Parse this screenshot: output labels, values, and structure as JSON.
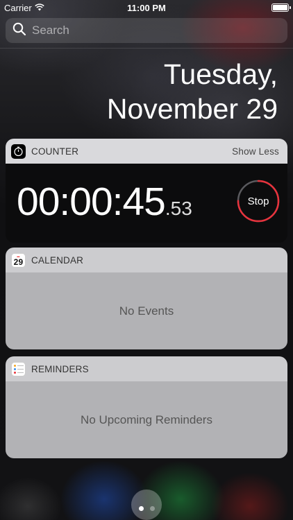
{
  "status_bar": {
    "carrier": "Carrier",
    "time": "11:00 PM",
    "battery_level": 1.0
  },
  "search": {
    "placeholder": "Search",
    "value": ""
  },
  "date": {
    "line1": "Tuesday,",
    "line2": "November 29"
  },
  "counter_widget": {
    "title": "COUNTER",
    "show_less_label": "Show Less",
    "time_main": "00:00:45",
    "time_fraction": ".53",
    "stop_label": "Stop",
    "ring_color": "#e8323c",
    "ring_progress": 0.75
  },
  "calendar_widget": {
    "title": "CALENDAR",
    "icon_day": "29",
    "empty_text": "No Events"
  },
  "reminders_widget": {
    "title": "REMINDERS",
    "empty_text": "No Upcoming Reminders"
  },
  "page_indicator": {
    "count": 2,
    "active": 0
  },
  "icons": {
    "search": "search-icon",
    "wifi": "wifi-icon",
    "battery": "battery-icon",
    "stopwatch": "stopwatch-icon",
    "calendar": "calendar-icon",
    "reminders": "reminders-icon"
  }
}
